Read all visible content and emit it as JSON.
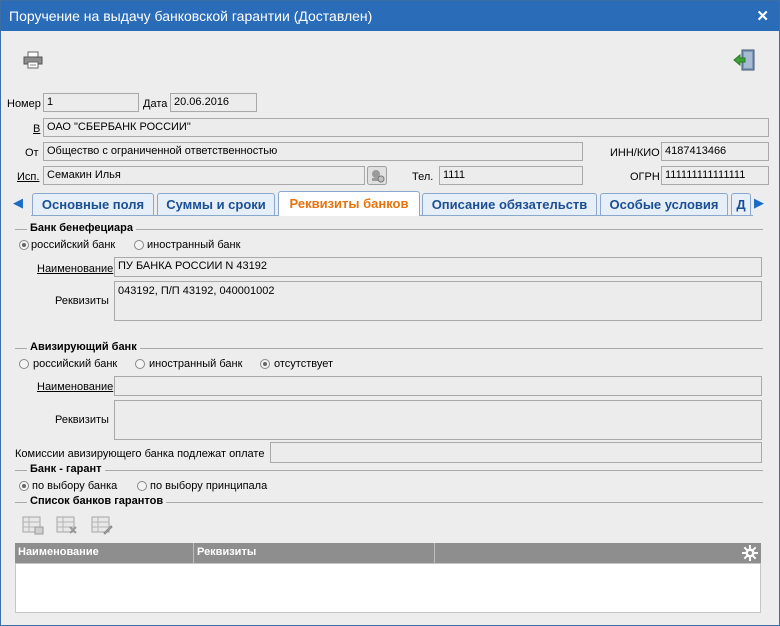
{
  "window": {
    "title": "Поручение на выдачу банковской гарантии (Доставлен)",
    "close_glyph": "✕"
  },
  "toolbar": {
    "print_icon": "printer-icon",
    "exit_icon": "exit-door-icon"
  },
  "header": {
    "number_label": "Номер",
    "number_value": "1",
    "date_label": "Дата",
    "date_value": "20.06.2016",
    "to_label": "В",
    "to_value": "ОАО \"СБЕРБАНК РОССИИ\"",
    "from_label": "От",
    "from_value": "Общество с ограниченной ответственностью",
    "inn_label": "ИНН/КИО",
    "inn_value": "4187413466",
    "executor_label": "Исп.",
    "executor_value": "Семакин Илья",
    "phone_label": "Тел.",
    "phone_value": "1111",
    "ogrn_label": "ОГРН",
    "ogrn_value": "111111111111111"
  },
  "tabs": [
    {
      "label": "Основные поля"
    },
    {
      "label": "Суммы и сроки"
    },
    {
      "label": "Реквизиты банков",
      "active": true
    },
    {
      "label": "Описание обязательств"
    },
    {
      "label": "Особые условия"
    },
    {
      "label": "Д"
    }
  ],
  "beneficiary_bank": {
    "title": "Банк бенефециара",
    "radio_russian": "российский банк",
    "radio_foreign": "иностранный банк",
    "selected": "russian",
    "name_label": "Наименование",
    "name_value": "ПУ БАНКА РОССИИ N 43192",
    "details_label": "Реквизиты",
    "details_value": "043192, П/П 43192, 040001002"
  },
  "advising_bank": {
    "title": "Авизирующий банк",
    "radio_russian": "российский банк",
    "radio_foreign": "иностранный банк",
    "radio_absent": "отсутствует",
    "selected": "absent",
    "name_label": "Наименование",
    "name_value": "",
    "details_label": "Реквизиты",
    "details_value": "",
    "commission_label": "Комиссии авизирующего банка подлежат оплате",
    "commission_value": ""
  },
  "guarantor_bank": {
    "title": "Банк - гарант",
    "radio_bank_choice": "по выбору банка",
    "radio_principal_choice": "по выбору принципала",
    "selected": "bank"
  },
  "guarantor_list": {
    "title": "Список банков гарантов",
    "columns": [
      "Наименование",
      "Реквизиты"
    ],
    "rows": []
  }
}
